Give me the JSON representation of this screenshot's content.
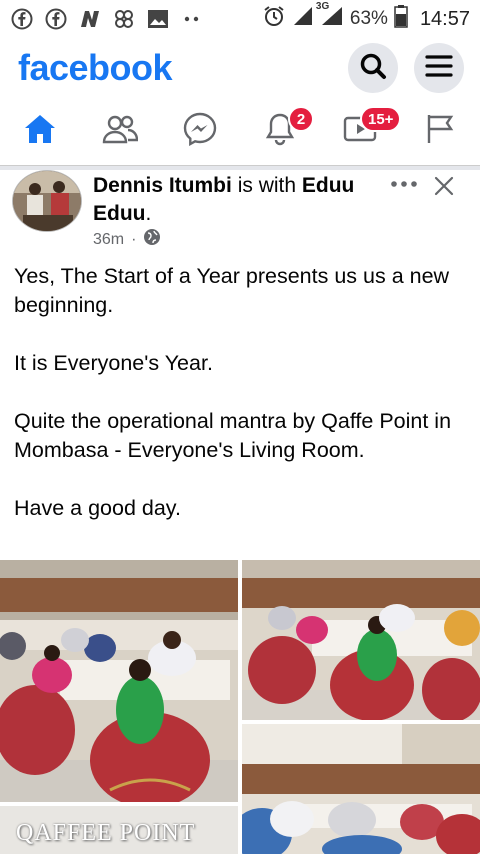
{
  "status": {
    "battery": "63%",
    "time": "14:57",
    "network": "3G",
    "icons": [
      "facebook-icon",
      "facebook-icon",
      "news-icon",
      "pinwheel-icon",
      "gallery-icon",
      "dots-icon",
      "alarm-icon",
      "signal-icon",
      "signal-3g-icon",
      "battery-icon"
    ]
  },
  "header": {
    "logo": "facebook",
    "search_icon": "search-icon",
    "menu_icon": "hamburger-menu-icon"
  },
  "nav": {
    "items": [
      {
        "name": "home",
        "icon": "home-icon",
        "active": true
      },
      {
        "name": "friends",
        "icon": "friends-icon"
      },
      {
        "name": "messenger",
        "icon": "messenger-icon"
      },
      {
        "name": "notifications",
        "icon": "bell-icon",
        "badge": "2"
      },
      {
        "name": "watch",
        "icon": "watch-icon",
        "badge": "15+"
      },
      {
        "name": "pages",
        "icon": "flag-icon"
      }
    ]
  },
  "post": {
    "author": "Dennis Itumbi",
    "with_text": "is with",
    "tagged": "Eduu Eduu",
    "time": "36m",
    "dot": "·",
    "paragraphs": [
      "Yes, The Start of a Year presents us us a new beginning.",
      "It is Everyone's Year.",
      "Quite the operational mantra by Qaffe Point in Mombasa - Everyone's Living Room.",
      "Have a good day."
    ],
    "sign_text": "QAFFEE POINT"
  },
  "colors": {
    "brand": "#1877f2",
    "badge": "#e41e3f",
    "meta": "#65676b"
  }
}
